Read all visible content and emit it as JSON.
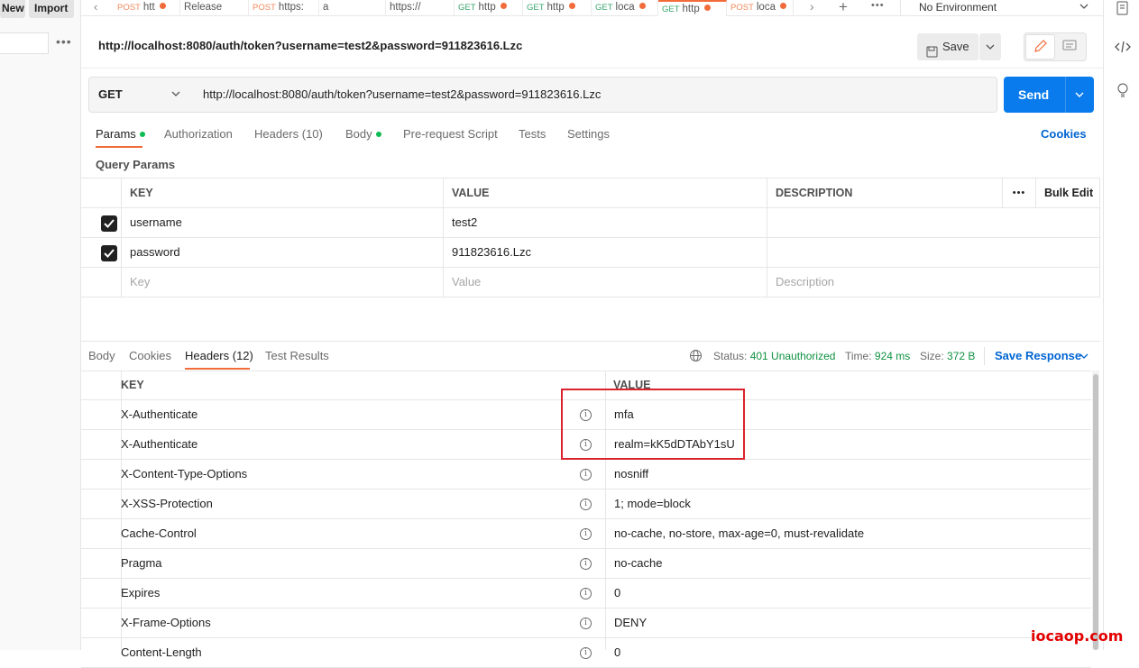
{
  "left": {
    "new_label": "New",
    "import_label": "Import",
    "more": "•••"
  },
  "tabs": [
    {
      "method": "POST",
      "label": "htt",
      "mclass": "post",
      "dot": true
    },
    {
      "method": "",
      "label": "Release",
      "mclass": "",
      "dot": false
    },
    {
      "method": "POST",
      "label": "https:",
      "mclass": "post",
      "dot": false
    },
    {
      "method": "",
      "label": "a",
      "mclass": "",
      "dot": false
    },
    {
      "method": "",
      "label": "https://",
      "mclass": "",
      "dot": false
    },
    {
      "method": "GET",
      "label": "http",
      "mclass": "get",
      "dot": true
    },
    {
      "method": "GET",
      "label": "http",
      "mclass": "get",
      "dot": true
    },
    {
      "method": "GET",
      "label": "loca",
      "mclass": "get",
      "dot": true
    },
    {
      "method": "GET",
      "label": "http",
      "mclass": "get",
      "dot": true
    },
    {
      "method": "POST",
      "label": "loca",
      "mclass": "post",
      "dot": true
    }
  ],
  "environment": "No Environment",
  "request": {
    "title_url": "http://localhost:8080/auth/token?username=test2&password=911823616.Lzc",
    "save_label": "Save",
    "method": "GET",
    "url": "http://localhost:8080/auth/token?username=test2&password=911823616.Lzc",
    "send_label": "Send",
    "tabs": {
      "params": "Params",
      "authorization": "Authorization",
      "headers": "Headers (10)",
      "body": "Body",
      "prerequest": "Pre-request Script",
      "tests": "Tests",
      "settings": "Settings"
    },
    "cookies_label": "Cookies"
  },
  "params": {
    "section_label": "Query Params",
    "columns": {
      "key": "KEY",
      "value": "VALUE",
      "description": "DESCRIPTION",
      "more": "•••",
      "bulk_edit": "Bulk Edit"
    },
    "rows": [
      {
        "key": "username",
        "value": "test2",
        "description": "",
        "checked": true
      },
      {
        "key": "password",
        "value": "911823616.Lzc",
        "description": "",
        "checked": true
      }
    ],
    "placeholder": {
      "key": "Key",
      "value": "Value",
      "description": "Description"
    }
  },
  "response": {
    "tabs": {
      "body": "Body",
      "cookies": "Cookies",
      "headers": "Headers (12)",
      "test_results": "Test Results"
    },
    "status_label": "Status:",
    "status_value": "401 Unauthorized",
    "time_label": "Time:",
    "time_value": "924 ms",
    "size_label": "Size:",
    "size_value": "372 B",
    "save_response": "Save Response",
    "columns": {
      "key": "KEY",
      "value": "VALUE"
    },
    "headers": [
      {
        "key": "X-Authenticate",
        "value": "mfa"
      },
      {
        "key": "X-Authenticate",
        "value": "realm=kK5dDTAbY1sU"
      },
      {
        "key": "X-Content-Type-Options",
        "value": "nosniff"
      },
      {
        "key": "X-XSS-Protection",
        "value": "1; mode=block"
      },
      {
        "key": "Cache-Control",
        "value": "no-cache, no-store, max-age=0, must-revalidate"
      },
      {
        "key": "Pragma",
        "value": "no-cache"
      },
      {
        "key": "Expires",
        "value": "0"
      },
      {
        "key": "X-Frame-Options",
        "value": "DENY"
      },
      {
        "key": "Content-Length",
        "value": "0"
      }
    ]
  },
  "watermark": "iocaop.com",
  "colors": {
    "accent": "#f26b3a",
    "send": "#097bed",
    "link": "#0265d2",
    "status_ok": "#0f9142",
    "highlight": "#d9232d"
  }
}
